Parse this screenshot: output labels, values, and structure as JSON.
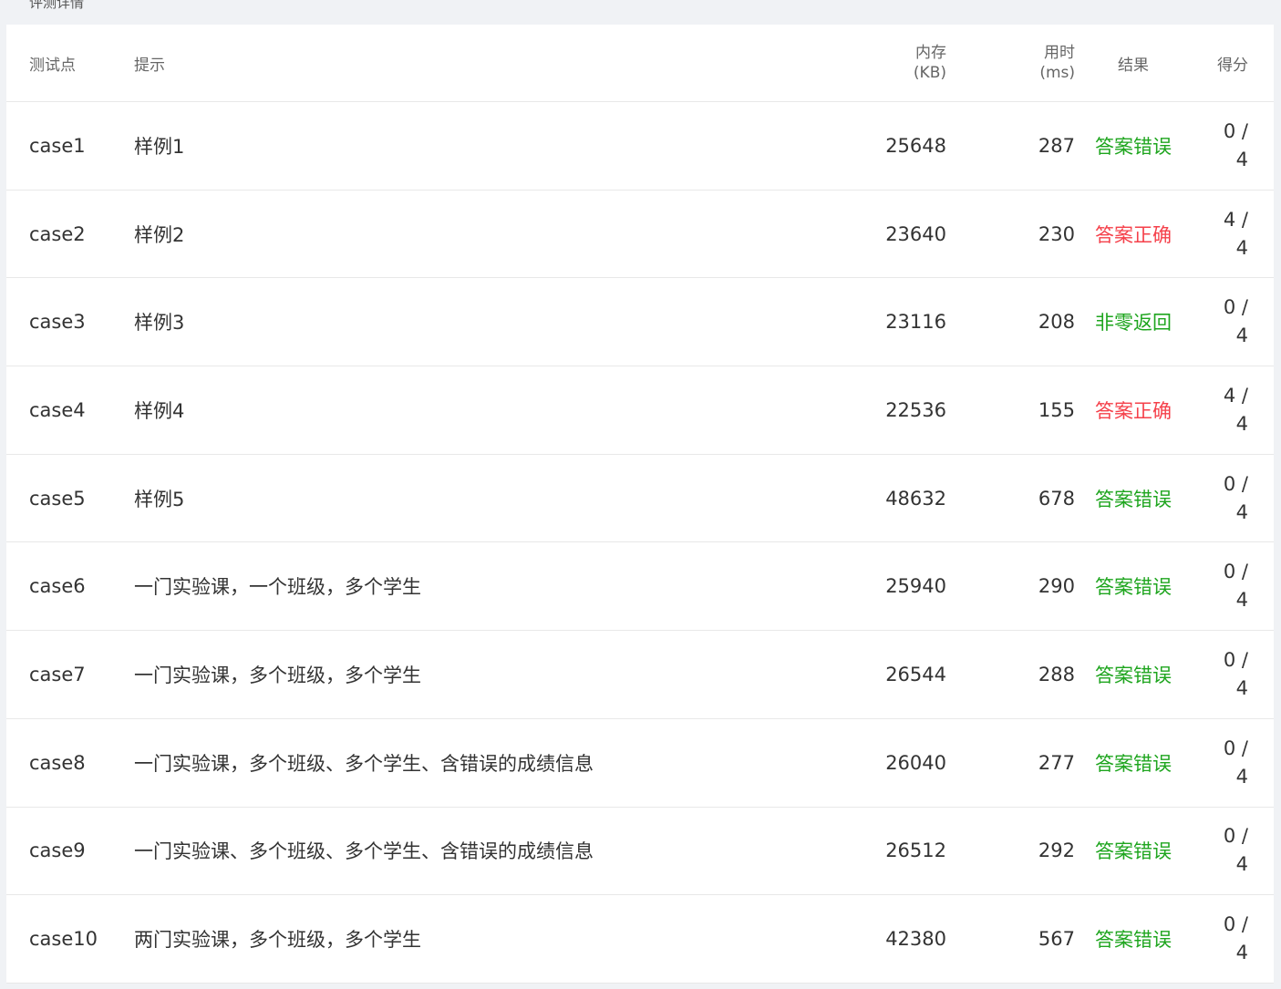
{
  "panel": {
    "title": "评测详情"
  },
  "headers": {
    "case": "测试点",
    "hint": "提示",
    "mem_line1": "内存",
    "mem_line2": "(KB)",
    "time_line1": "用时",
    "time_line2": "(ms)",
    "result": "结果",
    "score": "得分"
  },
  "colors": {
    "wrong": "#1ea51e",
    "correct": "#f5404a",
    "nonzero": "#1ea51e"
  },
  "rows": [
    {
      "case": "case1",
      "hint": "样例1",
      "mem": "25648",
      "time": "287",
      "result": "答案错误",
      "status": "wrong",
      "score_top": "0 /",
      "score_bottom": "4"
    },
    {
      "case": "case2",
      "hint": "样例2",
      "mem": "23640",
      "time": "230",
      "result": "答案正确",
      "status": "ok",
      "score_top": "4 /",
      "score_bottom": "4"
    },
    {
      "case": "case3",
      "hint": "样例3",
      "mem": "23116",
      "time": "208",
      "result": "非零返回",
      "status": "nonzero",
      "score_top": "0 /",
      "score_bottom": "4"
    },
    {
      "case": "case4",
      "hint": "样例4",
      "mem": "22536",
      "time": "155",
      "result": "答案正确",
      "status": "ok",
      "score_top": "4 /",
      "score_bottom": "4"
    },
    {
      "case": "case5",
      "hint": "样例5",
      "mem": "48632",
      "time": "678",
      "result": "答案错误",
      "status": "wrong",
      "score_top": "0 /",
      "score_bottom": "4"
    },
    {
      "case": "case6",
      "hint": "一门实验课，一个班级，多个学生",
      "mem": "25940",
      "time": "290",
      "result": "答案错误",
      "status": "wrong",
      "score_top": "0 /",
      "score_bottom": "4"
    },
    {
      "case": "case7",
      "hint": "一门实验课，多个班级，多个学生",
      "mem": "26544",
      "time": "288",
      "result": "答案错误",
      "status": "wrong",
      "score_top": "0 /",
      "score_bottom": "4"
    },
    {
      "case": "case8",
      "hint": "一门实验课，多个班级、多个学生、含错误的成绩信息",
      "mem": "26040",
      "time": "277",
      "result": "答案错误",
      "status": "wrong",
      "score_top": "0 /",
      "score_bottom": "4"
    },
    {
      "case": "case9",
      "hint": "一门实验课、多个班级、多个学生、含错误的成绩信息",
      "mem": "26512",
      "time": "292",
      "result": "答案错误",
      "status": "wrong",
      "score_top": "0 /",
      "score_bottom": "4"
    },
    {
      "case": "case10",
      "hint": "两门实验课，多个班级，多个学生",
      "mem": "42380",
      "time": "567",
      "result": "答案错误",
      "status": "wrong",
      "score_top": "0 /",
      "score_bottom": "4"
    }
  ]
}
